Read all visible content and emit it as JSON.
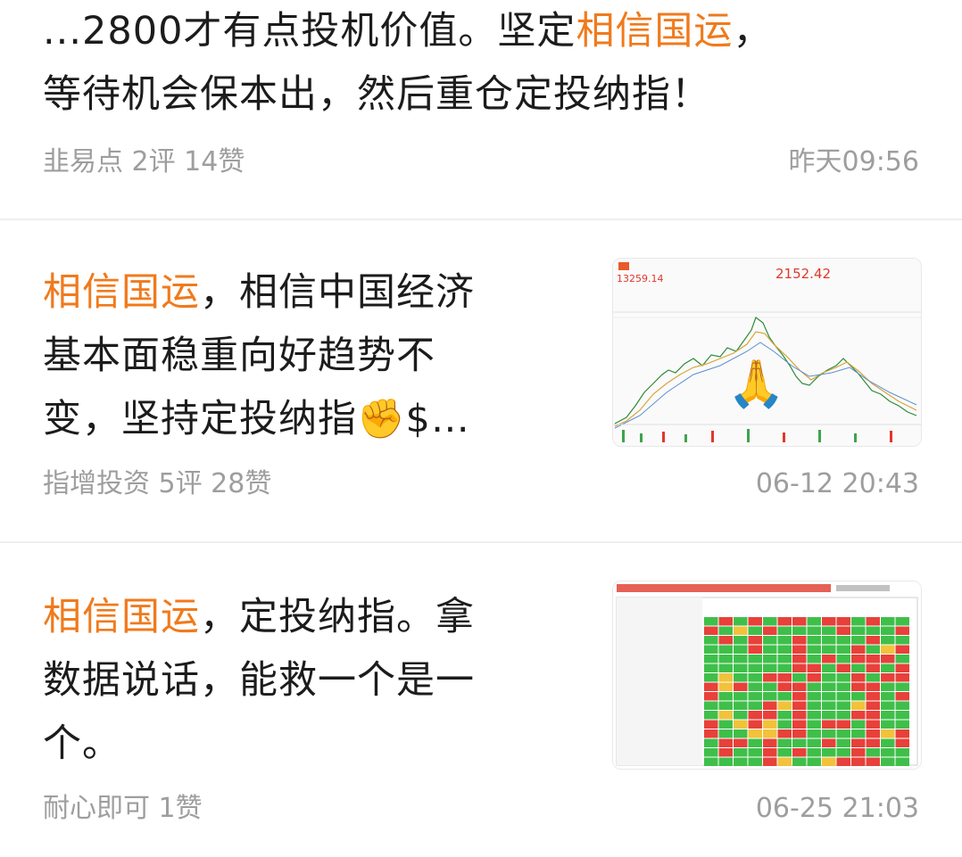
{
  "posts": [
    {
      "text_lines": [
        "...2800才有点投机价值。坚定",
        "，",
        "等待机会保本出，然后重仓定投纳指！"
      ],
      "tag": "相信国运",
      "source": "韭易点",
      "stats": "2评 14赞",
      "time": "昨天09:56"
    },
    {
      "tag": "相信国运",
      "line1_rest": "，相信中国经济",
      "line2": "基本面稳重向好趋势不",
      "line3": "变，坚持定投纳指✊$…",
      "source": "指增投资",
      "stats": "5评 28赞",
      "time": "06-12 20:43",
      "thumb": {
        "price_left": "13259.14",
        "price_right": "2152.42",
        "emoji": "🙏"
      }
    },
    {
      "tag": "相信国运",
      "line1_rest": "，定投纳指。拿",
      "line2": "数据说话，能救一个是一",
      "line3": "个。",
      "source": "耐心即可",
      "stats": "1赞",
      "time": "06-25 21:03"
    }
  ],
  "colors": {
    "tag": "#f07a1c",
    "meta": "#9e9e9e",
    "divider": "#efefef"
  }
}
